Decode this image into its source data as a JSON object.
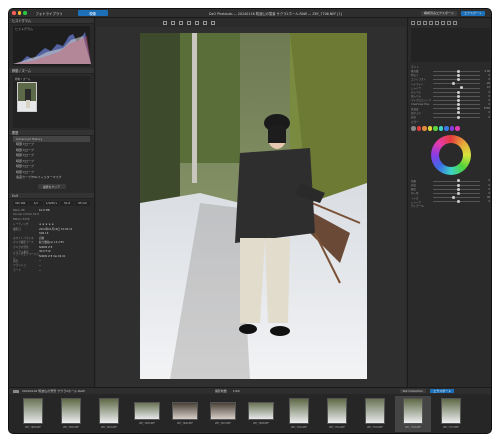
{
  "titlebar": {
    "library_tab": "フォトライブラリ",
    "develop_tab": "現像",
    "window_title": "DxO PhotoLab — 20240116 筑波山の雪景 サクラ2ホール.RAW — Z8Y_7706.NEF [1]",
    "export_button": "構成済みエクスポート",
    "share_button": "エクスポート"
  },
  "left_panel": {
    "histogram_title": "ヒストグラム",
    "histogram_label": "ヒストグラム",
    "thumbnail_title": "移動 / ズーム",
    "thumbnail_label": "移動 / ズーム",
    "history_title": "履歴",
    "history_items": [
      "Advanced History",
      "暗部スロープ",
      "暗部スロープ",
      "暗部スロープ",
      "暗部スロープ",
      "暗部スロープ",
      "暗部スロープ",
      "速度カーブ/HSLフィルターマスク"
    ],
    "selected_history_index": 0,
    "clear_button": "履歴をクリア",
    "exif_title": "Exif",
    "exif_values": [
      "ISO 100",
      "1/1",
      "1/1250 s",
      "f/1.8",
      "85 mm"
    ],
    "exif_rows": [
      {
        "k": "Nikon Z8",
        "v": "61.8 MB"
      },
      {
        "k": "Sonnar 2.0mm f/1.8",
        "v": ""
      },
      {
        "k": "8064 x 5376",
        "v": ""
      },
      {
        "k": "レーティング",
        "v": "★ ★ ★ ★ ★"
      },
      {
        "k": "撮影日",
        "v": "2024年01月16日 15:05:31"
      },
      {
        "k": "",
        "v": "SNS 16"
      },
      {
        "k": "ホワイトバランス",
        "v": "自動"
      },
      {
        "k": "カメラ撮影モード",
        "v": "絞り優先(A) 13.4 EV"
      },
      {
        "k": "カメラの型名",
        "v": "NIKON Z 8"
      },
      {
        "k": "シリアル番号",
        "v": "3017719"
      },
      {
        "k": "ソフトウェアバージョン",
        "v": "NIKON Z 8 Ver.02.01"
      },
      {
        "k": "測光",
        "v": "--"
      },
      {
        "k": "フラッシュ",
        "v": "--"
      },
      {
        "k": "モード",
        "v": "--"
      }
    ]
  },
  "right_panel": {
    "section_color": "カラー",
    "section_light": "ライト",
    "section_detail": "ディテール",
    "sliders": [
      {
        "label": "露光量",
        "value": "0.00",
        "pos": 0.5
      },
      {
        "label": "明るさ",
        "value": "0",
        "pos": 0.5
      },
      {
        "label": "コントラスト",
        "value": "0",
        "pos": 0.5
      },
      {
        "label": "ハイライト",
        "value": "-20",
        "pos": 0.4
      },
      {
        "label": "シャドウ",
        "value": "15",
        "pos": 0.58
      },
      {
        "label": "白レベル",
        "value": "0",
        "pos": 0.5
      },
      {
        "label": "黒レベル",
        "value": "0",
        "pos": 0.5
      },
      {
        "label": "マイクロコントラスト",
        "value": "0",
        "pos": 0.5
      },
      {
        "label": "ClearView Plus",
        "value": "0",
        "pos": 0.5
      },
      {
        "label": "色温度",
        "value": "5250",
        "pos": 0.52
      },
      {
        "label": "色かぶり",
        "value": "0",
        "pos": 0.5
      },
      {
        "label": "彩度",
        "value": "0",
        "pos": 0.5
      }
    ],
    "lower_sliders": [
      {
        "label": "色相",
        "value": "0",
        "pos": 0.5
      },
      {
        "label": "彩度",
        "value": "0",
        "pos": 0.5
      },
      {
        "label": "輝度",
        "value": "0",
        "pos": 0.5
      },
      {
        "label": "均一性",
        "value": "0",
        "pos": 0.5
      },
      {
        "label": "ノイズ",
        "value": "40",
        "pos": 0.4
      },
      {
        "label": "シャープ",
        "value": "0",
        "pos": 0.5
      }
    ],
    "swatch_colors": [
      "#888",
      "#e23b3b",
      "#e2893b",
      "#e2d23b",
      "#5bd23b",
      "#3bd2c7",
      "#3b78e2",
      "#8b3be2",
      "#e23bb0"
    ]
  },
  "filmstrip_bar": {
    "folder": "20240116 筑波山の雪景 サクラ2ホール.RAW",
    "count": "撮影枚数",
    "selected": "1/60",
    "nik_label": "Nik Collection",
    "export_label": "エクスポート"
  },
  "filmstrip": [
    {
      "name": "Z8Y_7689.NEF",
      "wide": false
    },
    {
      "name": "Z8Y_7690.NEF",
      "wide": false
    },
    {
      "name": "Z8Y_7693.NEF",
      "wide": false
    },
    {
      "name": "Z8Y_7695.NEF",
      "wide": true
    },
    {
      "name": "Z8Y_7696.NEF",
      "wide": true
    },
    {
      "name": "Z8Y_7697.NEF",
      "wide": true
    },
    {
      "name": "Z8Y_7698.NEF",
      "wide": true
    },
    {
      "name": "Z8Y_7700.NEF",
      "wide": false
    },
    {
      "name": "Z8Y_7701.NEF",
      "wide": false
    },
    {
      "name": "Z8Y_7702.NEF",
      "wide": false
    },
    {
      "name": "Z8Y_7706.NEF",
      "wide": false
    },
    {
      "name": "Z8Y_7707.NEF",
      "wide": false
    }
  ],
  "filmstrip_selected_index": 10
}
